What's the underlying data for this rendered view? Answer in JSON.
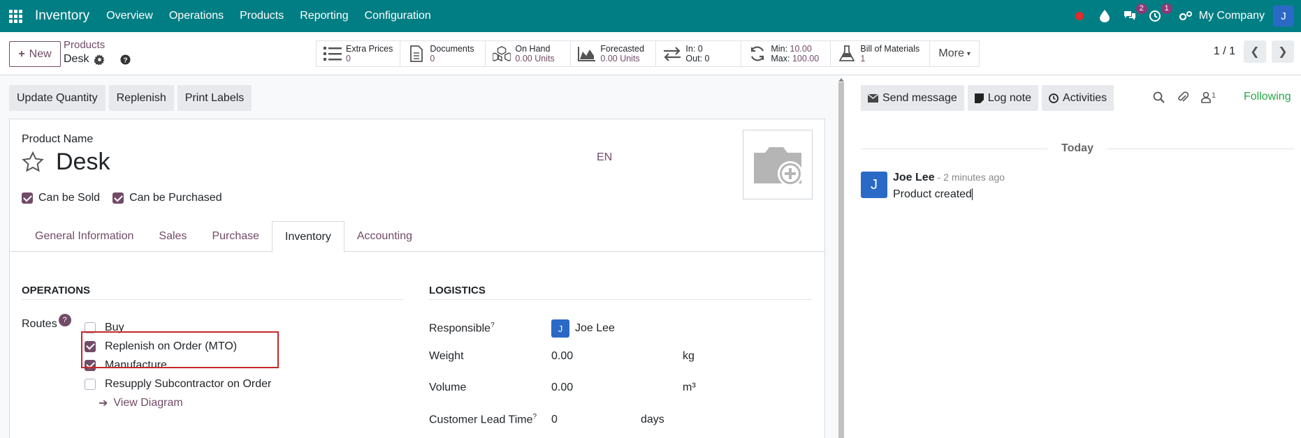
{
  "navbar": {
    "app_name": "Inventory",
    "menu": [
      "Overview",
      "Operations",
      "Products",
      "Reporting",
      "Configuration"
    ],
    "messages_badge": "2",
    "activities_badge": "1",
    "company": "My Company",
    "user_initial": "J",
    "accent": "#017e84"
  },
  "control_panel": {
    "new_label": "New",
    "breadcrumb_parent": "Products",
    "breadcrumb_current": "Desk",
    "smart_buttons": [
      {
        "label": "Extra Prices",
        "value": "0",
        "icon": "list-icon"
      },
      {
        "label": "Documents",
        "value": "0",
        "icon": "document-icon"
      },
      {
        "label": "On Hand",
        "value": "0.00 Units",
        "icon": "cubes-icon"
      },
      {
        "label": "Forecasted",
        "value": "0.00 Units",
        "icon": "area-chart-icon"
      },
      {
        "label": "In: 0",
        "value": "Out: 0",
        "icon": "exchange-icon"
      },
      {
        "label": "Min:",
        "label_value": "10.00",
        "value": "Max:",
        "value_value": "100.00",
        "icon": "refresh-icon"
      },
      {
        "label": "Bill of Materials",
        "value": "1",
        "icon": "flask-icon"
      }
    ],
    "more_label": "More",
    "pager": "1 / 1"
  },
  "status_bar": {
    "buttons": [
      "Update Quantity",
      "Replenish",
      "Print Labels"
    ]
  },
  "form": {
    "product_name_label": "Product Name",
    "product_name": "Desk",
    "lang": "EN",
    "can_be_sold": "Can be Sold",
    "can_be_purchased": "Can be Purchased",
    "tabs": [
      "General Information",
      "Sales",
      "Purchase",
      "Inventory",
      "Accounting"
    ],
    "active_tab": "Inventory",
    "operations_title": "OPERATIONS",
    "routes_label": "Routes",
    "routes_help": "?",
    "routes": [
      {
        "label": "Buy",
        "checked": false
      },
      {
        "label": "Replenish on Order (MTO)",
        "checked": true
      },
      {
        "label": "Manufacture",
        "checked": true
      },
      {
        "label": "Resupply Subcontractor on Order",
        "checked": false
      }
    ],
    "view_diagram": "View Diagram",
    "logistics_title": "LOGISTICS",
    "responsible_label": "Responsible",
    "responsible_value": "Joe Lee",
    "responsible_initial": "J",
    "weight_label": "Weight",
    "weight_value": "0.00",
    "weight_unit": "kg",
    "volume_label": "Volume",
    "volume_value": "0.00",
    "volume_unit": "m³",
    "lead_time_label": "Customer Lead Time",
    "lead_time_value": "0",
    "lead_time_unit": "days",
    "tooltip_mark": "?"
  },
  "chatter": {
    "send_message": "Send message",
    "log_note": "Log note",
    "activities": "Activities",
    "followers_count": "1",
    "following": "Following",
    "today": "Today",
    "message": {
      "author": "Joe Lee",
      "time": "- 2 minutes ago",
      "initial": "J",
      "body": "Product created"
    }
  }
}
